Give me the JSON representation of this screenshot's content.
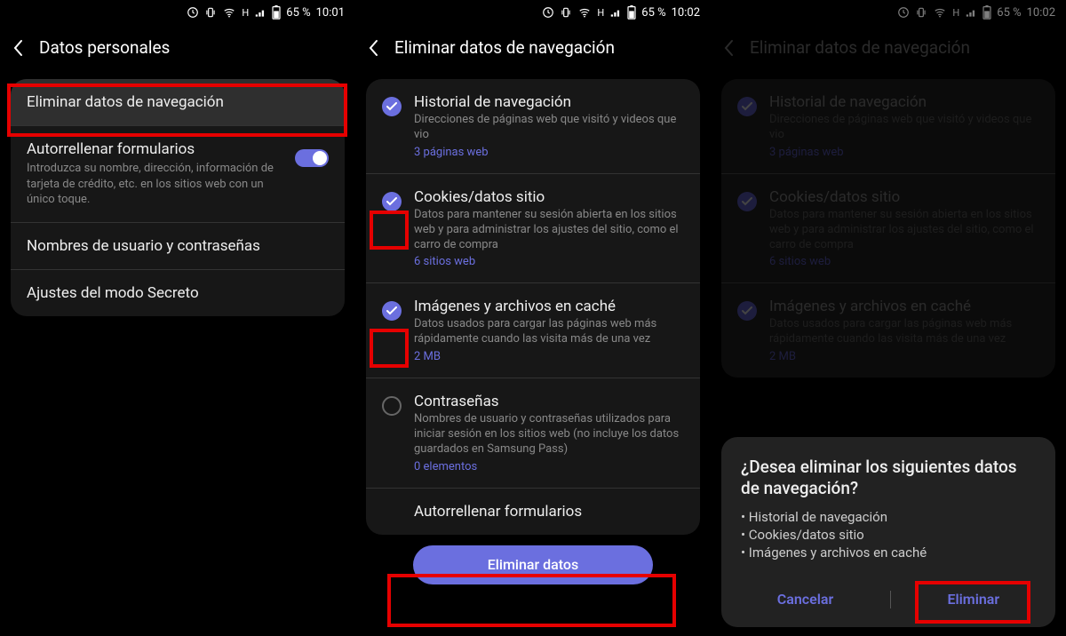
{
  "status": {
    "battery": "65 %",
    "network": "H",
    "t1": "10:01",
    "t2": "10:02",
    "t3": "10:02"
  },
  "s1": {
    "title": "Datos personales",
    "row1": "Eliminar datos de navegación",
    "row2_title": "Autorrellenar formularios",
    "row2_desc": "Introduzca su nombre, dirección, información de tarjeta de crédito, etc. en los sitios web con un único toque.",
    "row3": "Nombres de usuario y contraseñas",
    "row4": "Ajustes del modo Secreto"
  },
  "s2": {
    "title": "Eliminar datos de navegación",
    "items": [
      {
        "title": "Historial de navegación",
        "desc": "Direcciones de páginas web que visitó y videos que vio",
        "count": "3 páginas web",
        "on": true
      },
      {
        "title": "Cookies/datos sitio",
        "desc": "Datos para mantener su sesión abierta en los sitios web y para administrar los ajustes del sitio, como el carro de compra",
        "count": "6 sitios web",
        "on": true
      },
      {
        "title": "Imágenes y archivos en caché",
        "desc": "Datos usados para cargar las páginas web más rápidamente cuando las visita más de una vez",
        "count": "2 MB",
        "on": true
      },
      {
        "title": "Contraseñas",
        "desc": "Nombres de usuario y contraseñas utilizados para iniciar sesión en los sitios web (no incluye los datos guardados en Samsung Pass)",
        "count": "0 elementos",
        "on": false
      }
    ],
    "row5": "Autorrellenar formularios",
    "button": "Eliminar datos"
  },
  "s3": {
    "title": "Eliminar datos de navegación",
    "dialog_title": "¿Desea eliminar los siguientes datos de navegación?",
    "dialog_items": [
      "Historial de navegación",
      "Cookies/datos sitio",
      "Imágenes y archivos en caché"
    ],
    "cancel": "Cancelar",
    "confirm": "Eliminar"
  }
}
